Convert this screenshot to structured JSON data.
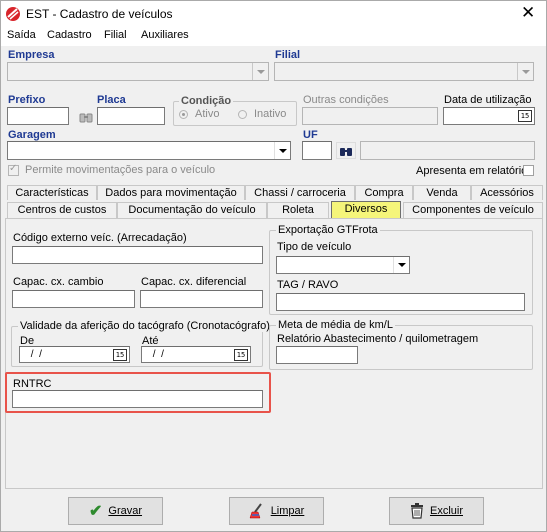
{
  "window": {
    "title": "EST - Cadastro de veículos"
  },
  "menu": [
    "Saída",
    "Cadastro",
    "Filial",
    "Auxiliares"
  ],
  "empresa": {
    "label": "Empresa",
    "value": ""
  },
  "filial": {
    "label": "Filial",
    "value": ""
  },
  "prefixo": {
    "label": "Prefixo",
    "value": ""
  },
  "placa": {
    "label": "Placa",
    "value": ""
  },
  "condicao": {
    "label": "Condição",
    "options": [
      "Ativo",
      "Inativo"
    ]
  },
  "outras_condicoes": {
    "label": "Outras condições"
  },
  "data_utilizacao": {
    "label": "Data de utilização",
    "value": ""
  },
  "garagem": {
    "label": "Garagem",
    "value": ""
  },
  "uf": {
    "label": "UF",
    "value": ""
  },
  "permite_mov": {
    "label": "Permite movimentações para o veículo",
    "checked": true
  },
  "apresenta": {
    "label": "Apresenta em relatórios",
    "checked": false
  },
  "tabs_row1": [
    "Características",
    "Dados para movimentação",
    "Chassi / carroceria",
    "Compra",
    "Venda",
    "Acessórios"
  ],
  "tabs_row2": [
    "Centros de custos",
    "Documentação do veículo",
    "Roleta",
    "Diversos",
    "Componentes de veículo"
  ],
  "diversos": {
    "codigo_externo": {
      "label": "Código externo veíc. (Arrecadação)",
      "value": ""
    },
    "capac_cambio": {
      "label": "Capac. cx. cambio",
      "value": ""
    },
    "capac_diferencial": {
      "label": "Capac. cx. diferencial",
      "value": ""
    },
    "exportacao": {
      "title": "Exportação GTFrota",
      "tipo_veiculo": {
        "label": "Tipo de veículo",
        "value": ""
      },
      "tag_label": "TAG / RAVO",
      "tag_value": ""
    },
    "validade": {
      "title": "Validade da aferição do tacógrafo (Cronotacógrafo)",
      "de_label": "De",
      "de_value": " /  /",
      "ate_label": "Até",
      "ate_value": " /  /"
    },
    "meta": {
      "title": "Meta de média de km/L",
      "rel_label": "Relatório Abastecimento / quilometragem",
      "value": ""
    },
    "rntrc": {
      "label": "RNTRC",
      "value": ""
    }
  },
  "buttons": {
    "gravar": "Gravar",
    "limpar": "Limpar",
    "excluir": "Excluir"
  },
  "colors": {
    "highlight": "#e8534a",
    "active_tab": "#f5f57a",
    "label_blue": "#1f3a93"
  }
}
